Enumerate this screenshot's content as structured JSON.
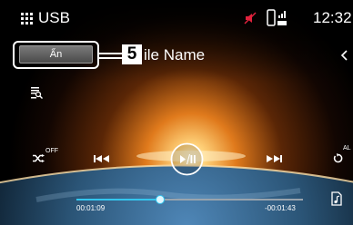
{
  "status_bar": {
    "source_label": "USB",
    "clock": "12:32",
    "icons": [
      "apps-grid-icon",
      "mute-icon",
      "phone-battery-icon"
    ]
  },
  "info_bar": {
    "hide_button_label": "Ẩn",
    "callout_number": "5",
    "file_name_label": "ile Name",
    "icons": [
      "collapse-icon",
      "list-icon"
    ]
  },
  "controls": {
    "shuffle_state": "OFF",
    "repeat_state": "AL",
    "icons": [
      "shuffle-icon",
      "previous-icon",
      "play-pause-icon",
      "next-icon",
      "repeat-icon"
    ]
  },
  "progress": {
    "elapsed": "00:01:09",
    "remaining": "-00:01:43",
    "fraction": 0.37,
    "icons": [
      "music-file-icon"
    ]
  },
  "colors": {
    "accent": "#34c6ee",
    "mute": "#e0223c",
    "horizon": "#ffb347"
  }
}
